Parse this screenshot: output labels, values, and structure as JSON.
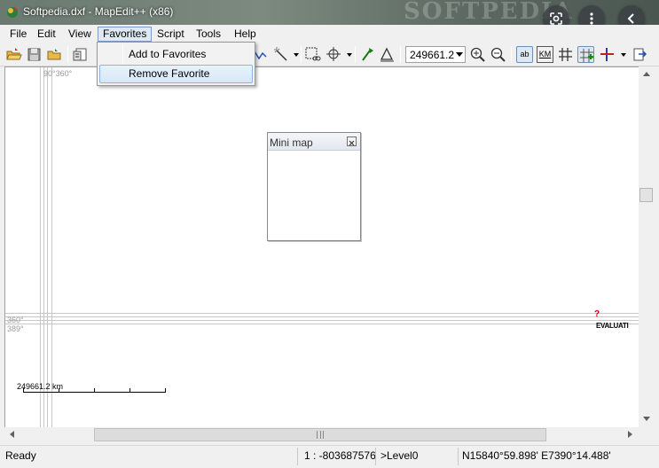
{
  "window": {
    "title": "Softpedia.dxf - MapEdit++ (x86)",
    "watermark": "SOFTPEDIA"
  },
  "menubar": {
    "items": [
      "File",
      "Edit",
      "View",
      "Favorites",
      "Script",
      "Tools",
      "Help"
    ]
  },
  "favorites_menu": {
    "add": "Add to Favorites",
    "remove": "Remove Favorite"
  },
  "toolbar": {
    "scale_value": "249661.2",
    "labels_button": "ab",
    "km_button": "KM"
  },
  "map": {
    "top_grid_label": "90°360°",
    "left_grid_label_1": "360°",
    "left_grid_label_2": "389°",
    "evaluation_text": "EVALUATI",
    "help_marker": "?",
    "scalebar_label": "249661.2 km"
  },
  "minimap": {
    "title": "Mini map"
  },
  "statusbar": {
    "state": "Ready",
    "scale": "1 : -803687576",
    "level": ">Level0",
    "coordinates": "N15840°59.898' E7390°14.488'"
  },
  "colors": {
    "accent": "#7c9ac2",
    "selection": "#d6e6f8",
    "canvas": "#ffffff",
    "chrome": "#f0f0f0"
  },
  "icons": [
    "open-folder-icon",
    "save-icon",
    "folder-up-icon",
    "properties-icon",
    "polyline-icon",
    "magic-wand-icon",
    "select-cut-icon",
    "move-icon",
    "pick-icon",
    "measure-icon",
    "zoom-in-icon",
    "zoom-out-icon",
    "labels-icon",
    "km-icon",
    "grid-icon",
    "add-node-icon",
    "crosshair-icon",
    "export-icon"
  ]
}
